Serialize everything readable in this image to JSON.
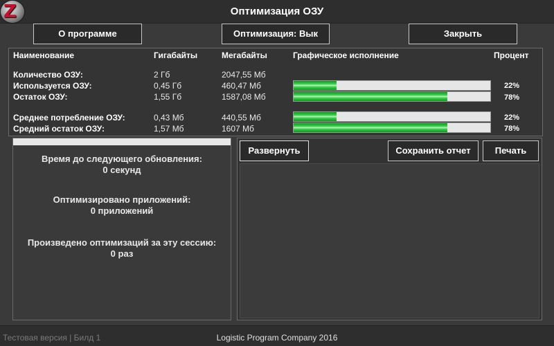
{
  "app": {
    "title": "Оптимизация ОЗУ",
    "logo_letter": "Z"
  },
  "toolbar": {
    "about_label": "О программе",
    "optimize_label": "Оптимизация: Вык",
    "close_label": "Закрыть"
  },
  "table": {
    "headers": {
      "name": "Наименование",
      "gb": "Гигабайты",
      "mb": "Мегабайты",
      "graph": "Графическое исполнение",
      "percent": "Процент"
    },
    "rows": [
      {
        "name": "Количество ОЗУ:",
        "gb": "2 Гб",
        "mb": "2047,55 Мб",
        "percent": "",
        "fill": null
      },
      {
        "name": "Используется ОЗУ:",
        "gb": "0,45 Гб",
        "mb": "460,47 Мб",
        "percent": "22%",
        "fill": 0.22
      },
      {
        "name": "Остаток ОЗУ:",
        "gb": "1,55 Гб",
        "mb": "1587,08 Мб",
        "percent": "78%",
        "fill": 0.78
      },
      {
        "name": "Среднее потребление ОЗУ:",
        "gb": "0,43 Мб",
        "mb": "440,55 Мб",
        "percent": "22%",
        "fill": 0.22
      },
      {
        "name": "Средний остаток ОЗУ:",
        "gb": "1,57 Мб",
        "mb": "1607 Мб",
        "percent": "78%",
        "fill": 0.78
      }
    ]
  },
  "info": {
    "next_update_label": "Время до следующего обновления:",
    "next_update_value": "0 секунд",
    "optimized_apps_label": "Оптимизировано приложений:",
    "optimized_apps_value": "0 приложений",
    "session_opt_label": "Произведено оптимизаций за эту сессию:",
    "session_opt_value": "0 раз"
  },
  "log_panel": {
    "expand_label": "Развернуть",
    "save_label": "Сохранить отчет",
    "print_label": "Печать"
  },
  "footer": {
    "version": "Тестовая версия | Билд 1",
    "company": "Logistic Program Company 2016"
  },
  "colors": {
    "bar_fill": "#2fc43f",
    "background": "#3a3a3a"
  }
}
